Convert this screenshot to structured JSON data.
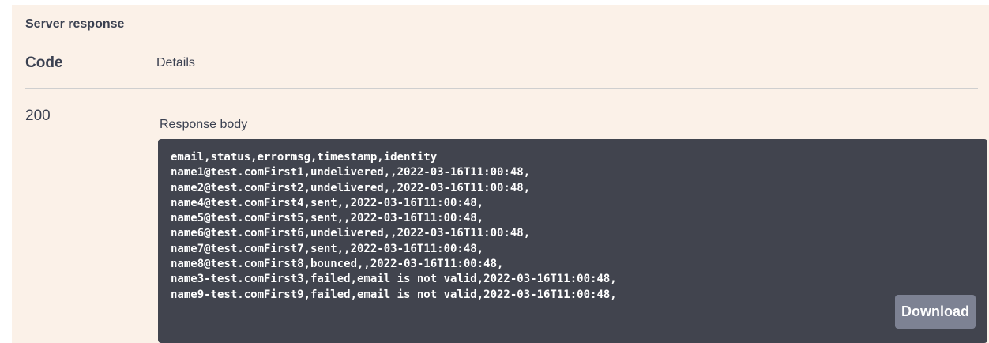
{
  "section": {
    "title": "Server response"
  },
  "table": {
    "headers": {
      "code": "Code",
      "details": "Details"
    },
    "row": {
      "status_code": "200",
      "body_label": "Response body",
      "body_lines": [
        "email,status,errormsg,timestamp,identity",
        "name1@test.comFirst1,undelivered,,2022-03-16T11:00:48,",
        "name2@test.comFirst2,undelivered,,2022-03-16T11:00:48,",
        "name4@test.comFirst4,sent,,2022-03-16T11:00:48,",
        "name5@test.comFirst5,sent,,2022-03-16T11:00:48,",
        "name6@test.comFirst6,undelivered,,2022-03-16T11:00:48,",
        "name7@test.comFirst7,sent,,2022-03-16T11:00:48,",
        "name8@test.comFirst8,bounced,,2022-03-16T11:00:48,",
        "name3-test.comFirst3,failed,email is not valid,2022-03-16T11:00:48,",
        "name9-test.comFirst9,failed,email is not valid,2022-03-16T11:00:48,"
      ],
      "download_label": "Download"
    }
  },
  "colors": {
    "panel_bg": "#fbf1e8",
    "code_bg": "#41444e",
    "button_bg": "#7d8293",
    "text": "#3b4151"
  }
}
